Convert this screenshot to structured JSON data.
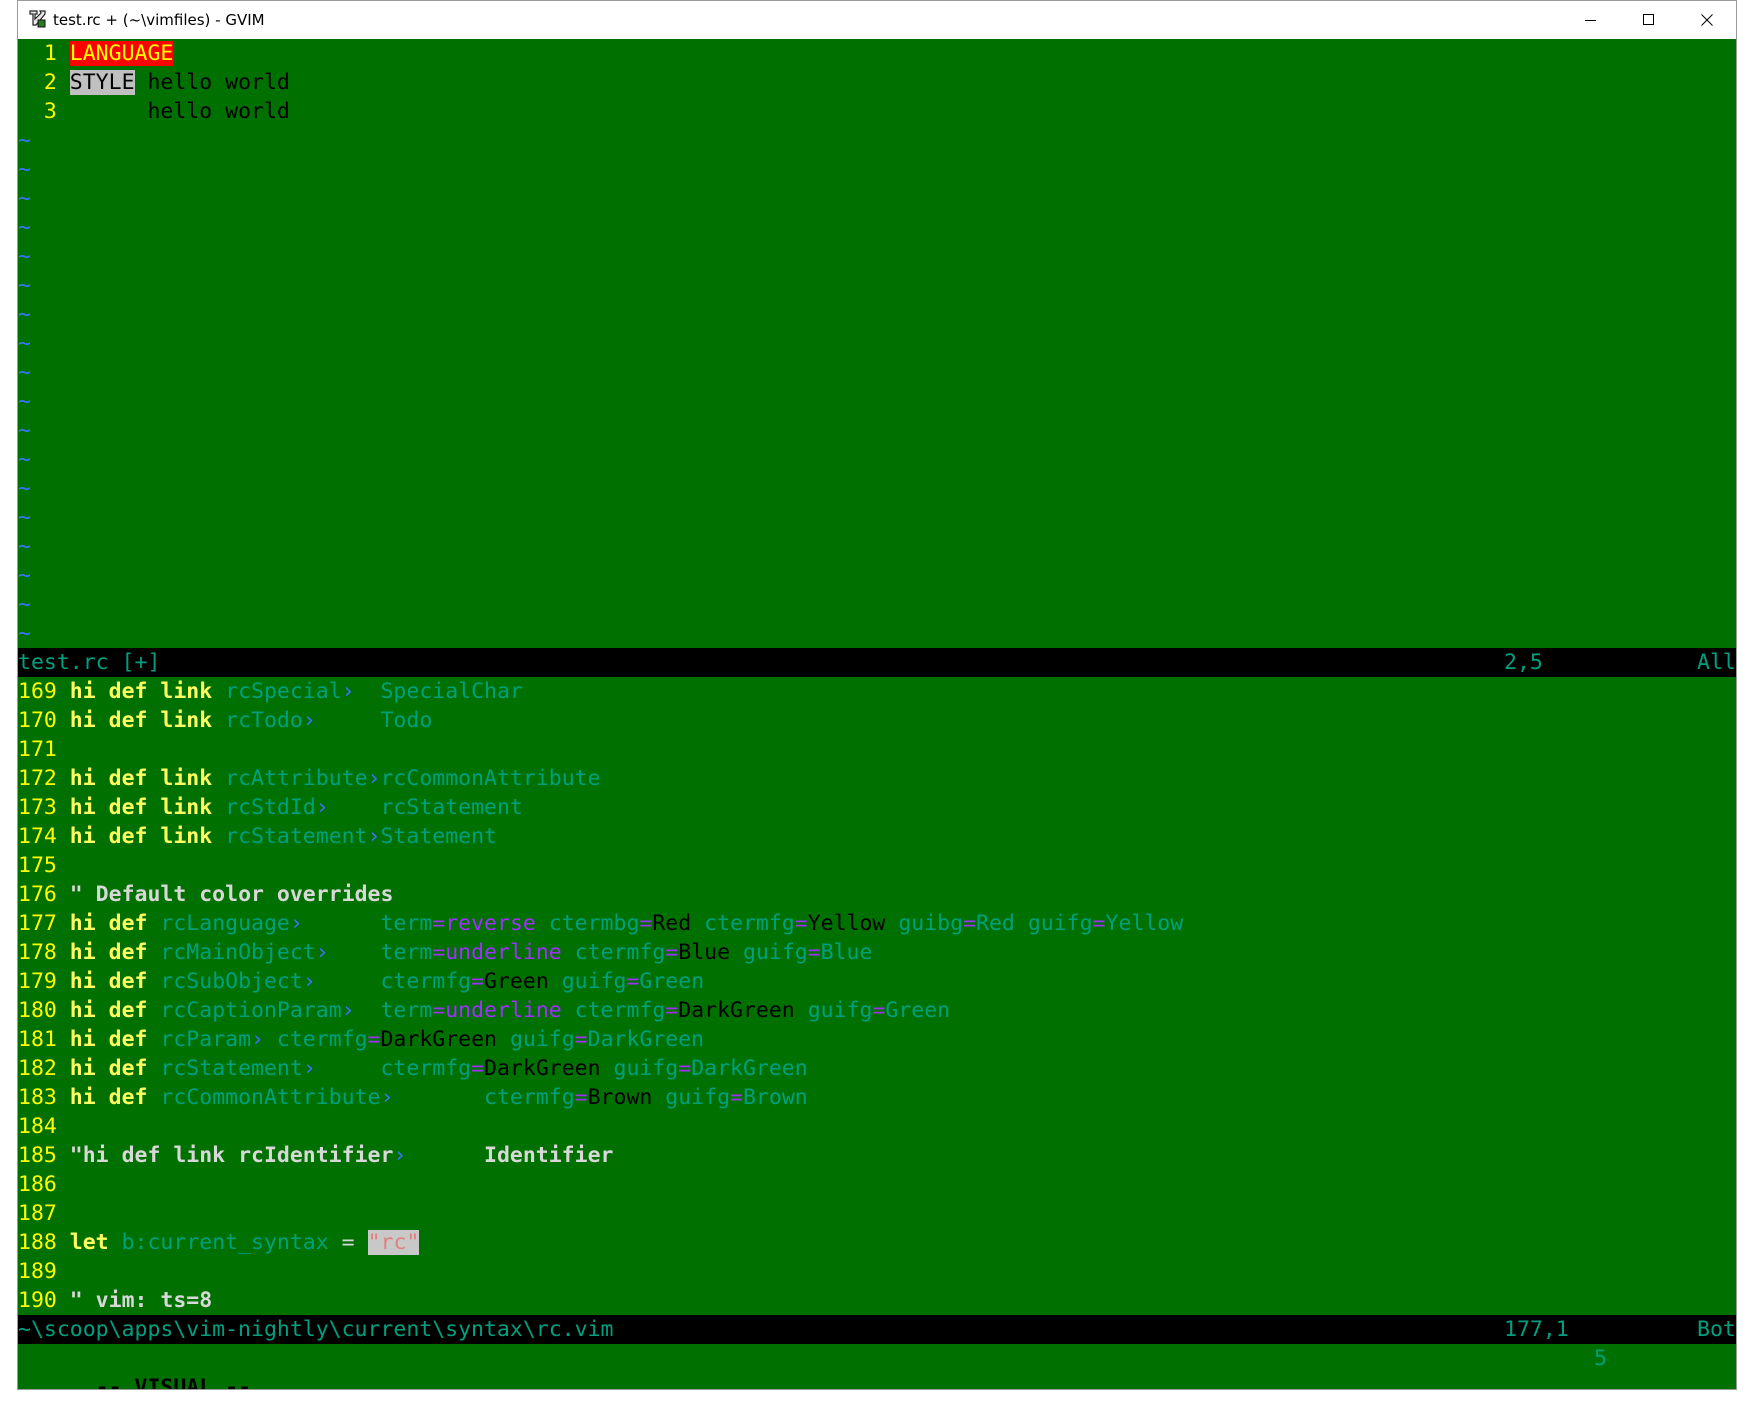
{
  "window": {
    "title": "test.rc + (~\\vimfiles) - GVIM",
    "icon": "gvim-icon"
  },
  "top_pane": {
    "lines": [
      {
        "num": "1",
        "text": "LANGUAGE"
      },
      {
        "num": "2",
        "text_hl": "STYLE",
        "text": " hello world"
      },
      {
        "num": "3",
        "text": "      hello world"
      }
    ],
    "tilde": "~",
    "status": {
      "file": "test.rc [+]",
      "pos": "2,5",
      "scroll": "All"
    }
  },
  "bottom_pane": {
    "lines": [
      {
        "num": "169",
        "kw": "hi def link",
        "group": "rcSpecial",
        "target": "SpecialChar"
      },
      {
        "num": "170",
        "kw": "hi def link",
        "group": "rcTodo",
        "target": "Todo"
      },
      {
        "num": "171"
      },
      {
        "num": "172",
        "kw": "hi def link",
        "group": "rcAttribute",
        "target": "rcCommonAttribute"
      },
      {
        "num": "173",
        "kw": "hi def link",
        "group": "rcStdId",
        "target": "rcStatement"
      },
      {
        "num": "174",
        "kw": "hi def link",
        "group": "rcStatement",
        "target": "Statement"
      },
      {
        "num": "175"
      },
      {
        "num": "176",
        "comment": "\" Default color overrides"
      },
      {
        "num": "177",
        "kw": "hi def",
        "group": "rcLanguage"
      },
      {
        "num": "178",
        "kw": "hi def",
        "group": "rcMainObject"
      },
      {
        "num": "179",
        "kw": "hi def",
        "group": "rcSubObject"
      },
      {
        "num": "180",
        "kw": "hi def",
        "group": "rcCaptionParam"
      },
      {
        "num": "181",
        "kw": "hi def",
        "group": "rcParam"
      },
      {
        "num": "182",
        "kw": "hi def",
        "group": "rcStatement"
      },
      {
        "num": "183",
        "kw": "hi def",
        "group": "rcCommonAttribute"
      },
      {
        "num": "184"
      },
      {
        "num": "185",
        "comment": "\"hi def link rcIdentifier",
        "comment2": "Identifier"
      },
      {
        "num": "186"
      },
      {
        "num": "187"
      },
      {
        "num": "188",
        "kw": "let",
        "var": "b:current_syntax",
        "op": "=",
        "str": "\"rc\""
      },
      {
        "num": "189"
      },
      {
        "num": "190",
        "comment": "\" vim: ts=8"
      }
    ],
    "attrs": {
      "term": "term",
      "ctermbg": "ctermbg",
      "ctermfg": "ctermfg",
      "guibg": "guibg",
      "guifg": "guifg",
      "eq": "=",
      "reverse": "reverse",
      "underline": "underline",
      "red": "Red",
      "yellow": "Yellow",
      "blue": "Blue",
      "green": "Green",
      "darkgreen": "DarkGreen",
      "brown": "Brown"
    },
    "status": {
      "file": "~\\scoop\\apps\\vim-nightly\\current\\syntax\\rc.vim",
      "pos": "177,1",
      "scroll": "Bot"
    }
  },
  "cmdline": {
    "mode": "-- VISUAL --",
    "count": "5"
  },
  "colors": {
    "background": "#007000",
    "line_number": "#ffff00",
    "keyword": "#ffff60",
    "group": "#00a07f",
    "separator": "#3b73ff",
    "special": "#a030ff",
    "language_highlight_bg": "#ff0000",
    "status_bg": "#000000"
  }
}
